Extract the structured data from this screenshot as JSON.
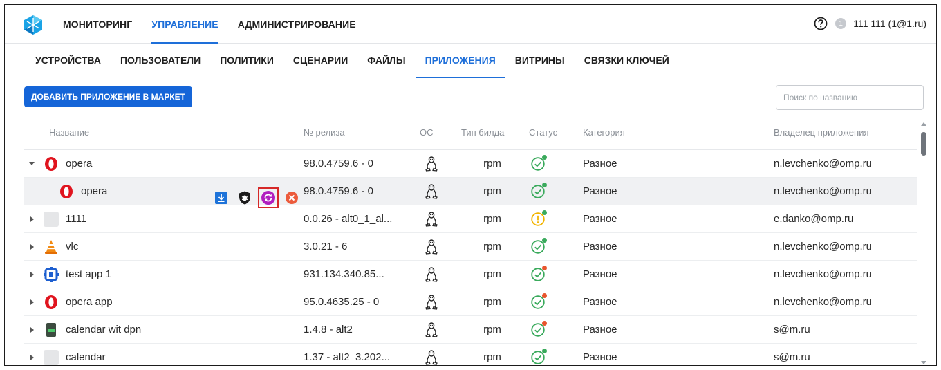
{
  "topnav": {
    "items": [
      "МОНИТОРИНГ",
      "УПРАВЛЕНИЕ",
      "АДМИНИСТРИРОВАНИЕ"
    ],
    "active": "УПРАВЛЕНИЕ"
  },
  "user": {
    "badge": "1",
    "name": "111 111 (1@1.ru)"
  },
  "subnav": {
    "items": [
      "УСТРОЙСТВА",
      "ПОЛЬЗОВАТЕЛИ",
      "ПОЛИТИКИ",
      "СЦЕНАРИИ",
      "ФАЙЛЫ",
      "ПРИЛОЖЕНИЯ",
      "ВИТРИНЫ",
      "СВЯЗКИ КЛЮЧЕЙ"
    ],
    "active": "ПРИЛОЖЕНИЯ"
  },
  "toolbar": {
    "add_label": "ДОБАВИТЬ ПРИЛОЖЕНИЕ В МАРКЕТ",
    "search_placeholder": "Поиск по названию",
    "search_value": ""
  },
  "table": {
    "headers": {
      "name": "Название",
      "release": "№ релиза",
      "os": "ОС",
      "build": "Тип билда",
      "status": "Статус",
      "category": "Категория",
      "owner": "Владелец приложения"
    },
    "rows": [
      {
        "name": "opera",
        "icon": "opera-icon",
        "release": "98.0.4759.6 - 0",
        "os": "linux-icon",
        "build": "rpm",
        "status": "ok",
        "dot": "green",
        "category": "Разное",
        "owner": "n.levchenko@omp.ru",
        "expanded": true,
        "sub": false
      },
      {
        "name": "opera",
        "icon": "opera-icon",
        "release": "98.0.4759.6 - 0",
        "os": "linux-icon",
        "build": "rpm",
        "status": "ok",
        "dot": "green",
        "category": "Разное",
        "owner": "n.levchenko@omp.ru",
        "sub": true,
        "selected": true
      },
      {
        "name": "1111",
        "icon": "placeholder-icon",
        "release": "0.0.26 - alt0_1_al...",
        "os": "linux-icon",
        "build": "rpm",
        "status": "warning",
        "dot": "green",
        "category": "Разное",
        "owner": "e.danko@omp.ru",
        "sub": false
      },
      {
        "name": "vlc",
        "icon": "vlc-icon",
        "release": "3.0.21 - 6",
        "os": "linux-icon",
        "build": "rpm",
        "status": "ok",
        "dot": "green",
        "category": "Разное",
        "owner": "n.levchenko@omp.ru",
        "sub": false
      },
      {
        "name": "test app 1",
        "icon": "test-app-icon",
        "release": "931.134.340.85...",
        "os": "linux-icon",
        "build": "rpm",
        "status": "ok",
        "dot": "red",
        "category": "Разное",
        "owner": "n.levchenko@omp.ru",
        "sub": false
      },
      {
        "name": "opera app",
        "icon": "opera-icon",
        "release": "95.0.4635.25 - 0",
        "os": "linux-icon",
        "build": "rpm",
        "status": "ok",
        "dot": "red",
        "category": "Разное",
        "owner": "n.levchenko@omp.ru",
        "sub": false
      },
      {
        "name": "calendar wit dpn",
        "icon": "calendar-app-icon",
        "release": "1.4.8 - alt2",
        "os": "linux-icon",
        "build": "rpm",
        "status": "ok",
        "dot": "red",
        "category": "Разное",
        "owner": "s@m.ru",
        "sub": false
      },
      {
        "name": "calendar",
        "icon": "placeholder-icon",
        "release": "1.37 - alt2_3.202...",
        "os": "linux-icon",
        "build": "rpm",
        "status": "ok",
        "dot": "green",
        "category": "Разное",
        "owner": "s@m.ru",
        "sub": false
      }
    ],
    "row_actions": [
      "download-icon",
      "bug-shield-icon",
      "sync-icon",
      "cancel-icon"
    ]
  },
  "colors": {
    "accent": "#1e6fd9",
    "button": "#1565d8",
    "ok": "#3aaa5c",
    "warning": "#f2b400",
    "dot_green": "#3aaa5c",
    "dot_red": "#e8552d",
    "highlight": "#d62828"
  }
}
